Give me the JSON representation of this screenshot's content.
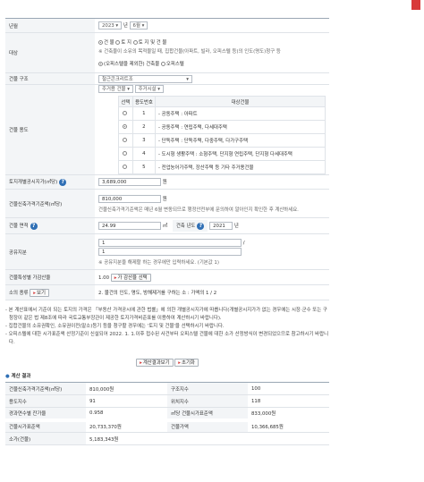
{
  "year_row": {
    "label": "년월",
    "year_value": "2023",
    "year_unit": "년",
    "month_value": "6월"
  },
  "target_row": {
    "label": "대상",
    "opt1": "건 물",
    "opt2": "토 지",
    "opt3": "토 지 및 건 물",
    "note": "※ 건축물이 소유의 목적물일 때, 집합건물(아파트, 빌라, 오피스텔 등)의 인도(명도)청구 등",
    "sub_opt1": "(오피스텔을 제외한) 건축물",
    "sub_opt2": "오피스텔"
  },
  "structure_row": {
    "label": "건물 구조",
    "value": "철근콘크리트조"
  },
  "use_row": {
    "label": "건물 용도",
    "sel1": "주거용 건물",
    "sel2": "주거시설",
    "headers": [
      "선택",
      "용도번호",
      "대상건물"
    ],
    "rows": [
      {
        "num": "1",
        "desc": "- 공동주택 : 아파트"
      },
      {
        "num": "2",
        "desc": "- 공동주택 : 연립주택, 다세대주택"
      },
      {
        "num": "3",
        "desc": "- 단독주택 : 단독주택, 다중주택, 다가구주택"
      },
      {
        "num": "4",
        "desc": "- 도시형 생활주택 : 소형주택, 단지형 연립주택, 단지형 다세대주택"
      },
      {
        "num": "5",
        "desc": "- 전업농어가주택, 장산주택 등 기타 주거용건물"
      }
    ],
    "selected_index": 1
  },
  "land_price_row": {
    "label": "토지개별공시지가(㎡당)",
    "value": "3,689,000",
    "unit": "원"
  },
  "new_price_row": {
    "label": "건물신축가격기준액(㎡당)",
    "value": "810,000",
    "unit": "원",
    "note": "건물신축가격기준액은 매년 6월 변동되므로 행정안전부에 문의하여 알아인지 확인한 후 계산하세요."
  },
  "area_row": {
    "label": "건물 면적",
    "value": "24.99",
    "unit": "㎡",
    "year_label": "건축 년도",
    "year_value": "2021",
    "year_unit": "년"
  },
  "share_row": {
    "label": "공유지분",
    "num": "1",
    "slash": "/",
    "den": "1",
    "note": "※ 공유지분을 해제할 하는 경우에만 입력하세요. (기본값 1)"
  },
  "premium_row": {
    "label": "건물특성별 가감산율",
    "value": "1.00",
    "button": "가 감산율 선택"
  },
  "kind_row": {
    "label": "소의 종류",
    "button": "보기",
    "value": "2. 물건의 인도, 명도, 방해제거를 구하는 소 : 가액의 1 / 2"
  },
  "notes": [
    "- 본 계산표에서 기준이 되는 토지의 가격은 「부동산 가격공시에 관한 법률」에 의한 개별공시지가에 따릅니다(개별공시지가가 없는 경우에는 시장·군수 또는 구청장이 같은 법 제8조에 따라 국토교통부장관이 제공한 토지가격비준표를 이용하여 계산하시기 바랍니다).",
    "- 집합건물의 소유권확인, 소유권이전(말소)등기 등을 청구할 경우에는 '토지 및 건물'을 선택하시기 바랍니다.",
    "- 오피스텔에 대한 시가표준액 산정기준이 신설되어 2022. 1. 1.이후 접수된 사건부터 오피스텔 건물에 대한 소가 산정방식이 변경되었으므로 참고하시기 바랍니다."
  ],
  "buttons": {
    "calc": "계산결과보기",
    "reset": "초기화"
  },
  "results": {
    "title": "계산 결과",
    "rows": [
      [
        {
          "k": "건물신축가격기준액(㎡당)",
          "v": "810,000원"
        },
        {
          "k": "구조지수",
          "v": "100"
        }
      ],
      [
        {
          "k": "용도지수",
          "v": "91"
        },
        {
          "k": "위치지수",
          "v": "118"
        }
      ],
      [
        {
          "k": "경과연수별 잔가율",
          "v": "0.958"
        },
        {
          "k": "㎡당 건물시가표준액",
          "v": "833,000원"
        }
      ],
      [
        {
          "k": "건물시가표준액",
          "v": "20,733,370원"
        },
        {
          "k": "건물가액",
          "v": "10,366,685원"
        }
      ],
      [
        {
          "k": "소가(건물)",
          "v": "5,183,343원"
        }
      ]
    ]
  }
}
